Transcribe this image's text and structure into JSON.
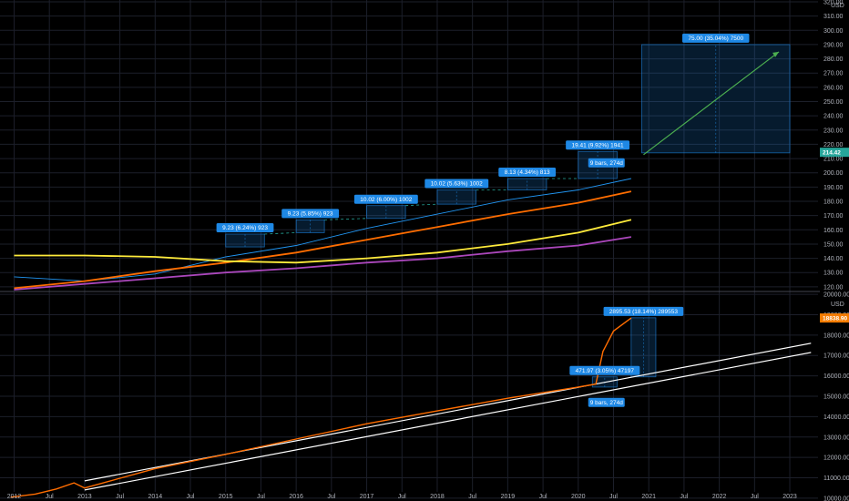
{
  "colors": {
    "background": "#000000",
    "grid": "#1c1f2a",
    "accent_blue": "#1e88e5",
    "blue_line": "#2196f3",
    "orange": "#ff6d00",
    "yellow": "#ffeb3b",
    "purple": "#ab47bc",
    "green": "#4caf50",
    "white": "#ffffff",
    "badge_orange": "#f57c00",
    "badge_green": "#26a69a"
  },
  "chart_data": [
    {
      "type": "line",
      "pane": "upper",
      "unit_label": "USD",
      "ylim": [
        118,
        320
      ],
      "y_ticks": [
        320,
        310,
        300,
        290,
        280,
        270,
        260,
        250,
        240,
        230,
        220,
        210,
        200,
        190,
        180,
        170,
        160,
        150,
        140,
        130,
        120
      ],
      "y_tick_labels": [
        "320.00",
        "310.00",
        "300.00",
        "290.00",
        "280.00",
        "270.00",
        "260.00",
        "250.00",
        "240.00",
        "230.00",
        "220.00",
        "210.00",
        "200.00",
        "190.00",
        "180.00",
        "170.00",
        "160.00",
        "150.00",
        "140.00",
        "130.00",
        "120.00"
      ],
      "last_value_label": "214.42",
      "series": [
        {
          "color": "blue_line",
          "points": [
            [
              2012.0,
              127
            ],
            [
              2013.0,
              124
            ],
            [
              2014.0,
              129
            ],
            [
              2015.0,
              141
            ],
            [
              2016.0,
              149
            ],
            [
              2017.0,
              161
            ],
            [
              2018.0,
              171
            ],
            [
              2019.0,
              181
            ],
            [
              2020.0,
              188
            ],
            [
              2020.75,
              196
            ]
          ]
        },
        {
          "color": "orange",
          "points": [
            [
              2012.0,
              119
            ],
            [
              2013.0,
              124
            ],
            [
              2014.0,
              131
            ],
            [
              2015.0,
              137
            ],
            [
              2016.0,
              144
            ],
            [
              2017.0,
              153
            ],
            [
              2018.0,
              162
            ],
            [
              2019.0,
              171
            ],
            [
              2020.0,
              179
            ],
            [
              2020.75,
              187
            ]
          ]
        },
        {
          "color": "yellow",
          "points": [
            [
              2012.0,
              142
            ],
            [
              2013.0,
              142
            ],
            [
              2014.0,
              141
            ],
            [
              2015.0,
              138
            ],
            [
              2016.0,
              137
            ],
            [
              2017.0,
              140
            ],
            [
              2018.0,
              144
            ],
            [
              2019.0,
              150
            ],
            [
              2020.0,
              158
            ],
            [
              2020.75,
              167
            ]
          ]
        },
        {
          "color": "purple",
          "points": [
            [
              2012.0,
              118
            ],
            [
              2013.0,
              122
            ],
            [
              2014.0,
              126
            ],
            [
              2015.0,
              130
            ],
            [
              2016.0,
              133
            ],
            [
              2017.0,
              137
            ],
            [
              2018.0,
              140
            ],
            [
              2019.0,
              145
            ],
            [
              2020.0,
              149
            ],
            [
              2020.75,
              155
            ]
          ]
        }
      ],
      "ranges": [
        {
          "label": "9.23 (6.24%) 923",
          "x0": 2015.0,
          "x1": 2015.55,
          "y0": 148,
          "y1": 157
        },
        {
          "label": "9.23 (5.85%) 923",
          "x0": 2016.0,
          "x1": 2016.4,
          "y0": 158,
          "y1": 167
        },
        {
          "label": "10.02 (6.00%) 1002",
          "x0": 2017.0,
          "x1": 2017.55,
          "y0": 168,
          "y1": 177
        },
        {
          "label": "10.02 (5.63%) 1002",
          "x0": 2018.0,
          "x1": 2018.55,
          "y0": 178,
          "y1": 188
        },
        {
          "label": "8.13 (4.34%) 813",
          "x0": 2019.0,
          "x1": 2019.55,
          "y0": 188,
          "y1": 196
        },
        {
          "label": "19.41 (9.92%) 1941",
          "x0": 2020.0,
          "x1": 2020.55,
          "y0": 196,
          "y1": 215
        },
        {
          "label": "75.00 (35.04%) 7500",
          "x0": 2020.9,
          "x1": 2023.0,
          "y0": 214,
          "y1": 290
        }
      ],
      "bars_label": "9 bars, 274d"
    },
    {
      "type": "line",
      "pane": "lower",
      "unit_label": "USD",
      "ylim": [
        9950,
        20050
      ],
      "y_ticks": [
        20000,
        19000,
        18000,
        17000,
        16000,
        15000,
        14000,
        13000,
        12000,
        11000,
        10000
      ],
      "y_tick_labels": [
        "20000.00",
        "19000.00",
        "18000.00",
        "17000.00",
        "16000.00",
        "15000.00",
        "14000.00",
        "13000.00",
        "12000.00",
        "11000.00",
        "10000.00"
      ],
      "last_value_label": "18838.90",
      "series": [
        {
          "color": "orange",
          "points": [
            [
              2011.95,
              10050
            ],
            [
              2012.3,
              10200
            ],
            [
              2012.6,
              10450
            ],
            [
              2012.85,
              10750
            ],
            [
              2013.0,
              10500
            ],
            [
              2014.0,
              11450
            ],
            [
              2015.0,
              12150
            ],
            [
              2016.0,
              12900
            ],
            [
              2017.0,
              13650
            ],
            [
              2018.0,
              14280
            ],
            [
              2019.0,
              14900
            ],
            [
              2020.0,
              15450
            ],
            [
              2020.25,
              15600
            ],
            [
              2020.35,
              17200
            ],
            [
              2020.5,
              18200
            ],
            [
              2020.75,
              18840
            ]
          ]
        }
      ],
      "trend_lines": [
        {
          "color": "white",
          "points": [
            [
              2013.0,
              10850
            ],
            [
              2023.3,
              17600
            ]
          ]
        },
        {
          "color": "white",
          "points": [
            [
              2013.0,
              10400
            ],
            [
              2023.3,
              17150
            ]
          ]
        }
      ],
      "ranges": [
        {
          "label": "2895.53 (18.14%) 289553",
          "x0": 2020.75,
          "x1": 2021.1,
          "y0": 15950,
          "y1": 18850
        },
        {
          "label": "471.97 (3.05%) 47197",
          "x0": 2020.2,
          "x1": 2020.55,
          "y0": 15450,
          "y1": 15950
        }
      ],
      "bars_label": "9 bars, 274d"
    }
  ],
  "x_axis": {
    "labels": [
      "2012",
      "Jul",
      "2013",
      "Jul",
      "2014",
      "Jul",
      "2015",
      "Jul",
      "2016",
      "Jul",
      "2017",
      "Jul",
      "2018",
      "Jul",
      "2019",
      "Jul",
      "2020",
      "Jul",
      "2021",
      "Jul",
      "2022",
      "Jul",
      "2023"
    ]
  }
}
